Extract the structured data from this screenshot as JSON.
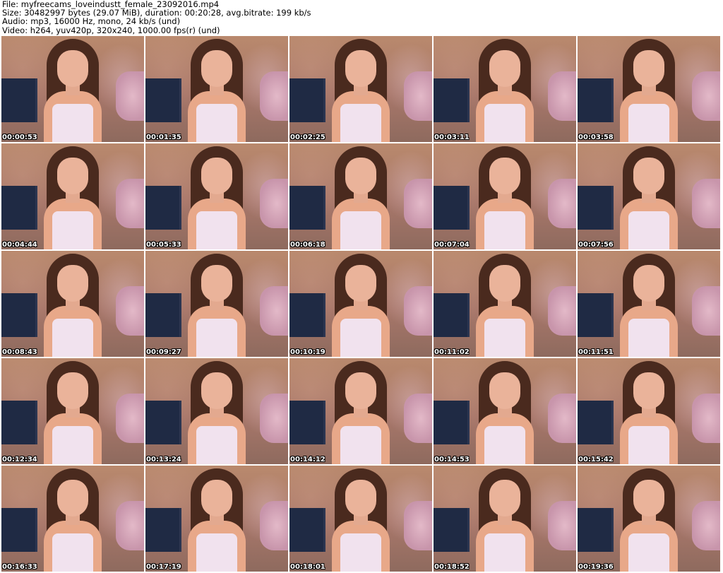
{
  "header": {
    "file": "File: myfreecams_loveindustt_female_23092016.mp4",
    "size": "Size: 30482997 bytes (29.07 MiB), duration: 00:20:28, avg.bitrate: 199 kb/s",
    "audio": "Audio: mp3, 16000 Hz, mono, 24 kb/s (und)",
    "video": "Video: h264, yuv420p, 320x240, 1000.00 fps(r) (und)"
  },
  "thumbnails": [
    "00:00:53",
    "00:01:35",
    "00:02:25",
    "00:03:11",
    "00:03:58",
    "00:04:44",
    "00:05:33",
    "00:06:18",
    "00:07:04",
    "00:07:56",
    "00:08:43",
    "00:09:27",
    "00:10:19",
    "00:11:02",
    "00:11:51",
    "00:12:34",
    "00:13:24",
    "00:14:12",
    "00:14:53",
    "00:15:42",
    "00:16:33",
    "00:17:19",
    "00:18:01",
    "00:18:52",
    "00:19:36"
  ]
}
